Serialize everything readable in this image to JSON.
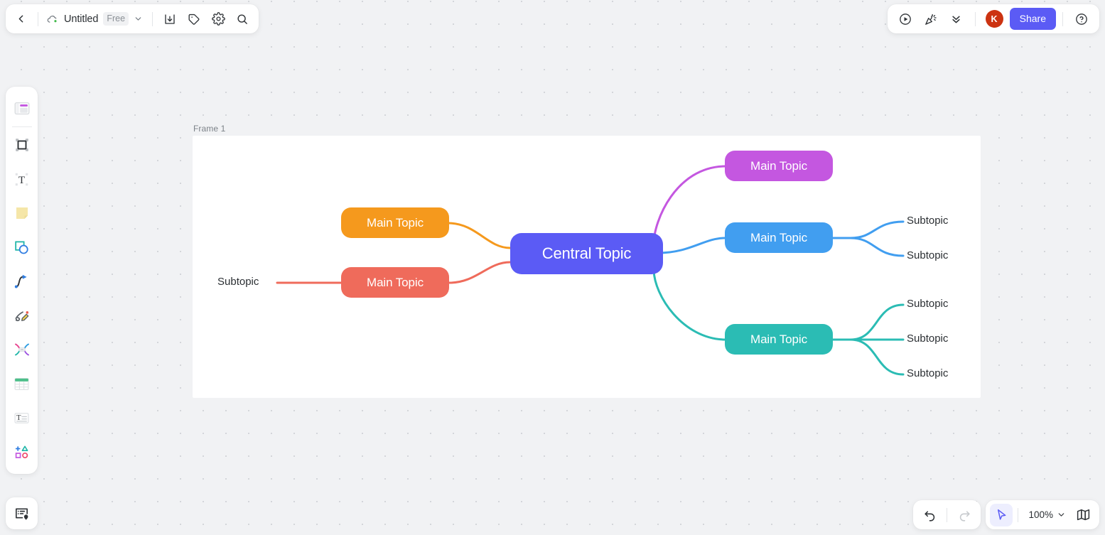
{
  "app": {
    "canvas_bg": "#f1f2f4",
    "accent": "#5b5bf5"
  },
  "topbar_left": {
    "back_icon": "chevron-left-icon",
    "cloud_icon": "cloud-saved-icon",
    "doc_title": "Untitled",
    "plan_badge": "Free",
    "caret_icon": "chevron-down-icon",
    "buttons": [
      {
        "name": "export-button",
        "icon": "download-icon"
      },
      {
        "name": "tag-button",
        "icon": "tag-icon"
      },
      {
        "name": "settings-button",
        "icon": "gear-icon"
      },
      {
        "name": "search-button",
        "icon": "search-icon"
      }
    ]
  },
  "topbar_right": {
    "buttons": [
      {
        "name": "present-button",
        "icon": "play-circle-icon"
      },
      {
        "name": "celebrate-button",
        "icon": "party-popper-icon"
      },
      {
        "name": "collapse-button",
        "icon": "chevrons-down-icon"
      }
    ],
    "avatar_initial": "K",
    "avatar_color": "#cc3311",
    "share_label": "Share",
    "help_icon": "question-circle-icon"
  },
  "tool_rail": {
    "items": [
      {
        "name": "template-tool",
        "icon": "template-icon"
      },
      {
        "name": "frame-tool",
        "icon": "frame-icon"
      },
      {
        "name": "text-tool",
        "icon": "text-box-icon"
      },
      {
        "name": "sticky-note-tool",
        "icon": "sticky-note-icon"
      },
      {
        "name": "shape-tool",
        "icon": "shapes-icon"
      },
      {
        "name": "connector-tool",
        "icon": "curve-connector-icon"
      },
      {
        "name": "pen-tool",
        "icon": "pencil-scribble-icon"
      },
      {
        "name": "mindmap-tool",
        "icon": "mindmap-icon"
      },
      {
        "name": "table-tool",
        "icon": "table-icon"
      },
      {
        "name": "comment-tool",
        "icon": "text-block-icon"
      },
      {
        "name": "more-tool",
        "icon": "add-shapes-icon"
      }
    ]
  },
  "bottom_left": {
    "name": "presentation-frames-button",
    "icon": "slide-pin-icon"
  },
  "bottom_right": {
    "undo_icon": "undo-arrow-icon",
    "redo_icon": "redo-arrow-icon",
    "cursor_icon": "cursor-pointer-icon",
    "zoom_level": "100%",
    "zoom_caret_icon": "chevron-down-icon",
    "minimap_icon": "map-icon"
  },
  "canvas": {
    "frame_label": "Frame 1"
  },
  "mindmap": {
    "central": {
      "label": "Central Topic",
      "color": "#5b5bf5"
    },
    "branches": [
      {
        "label": "Main Topic",
        "color": "#f5991d",
        "side": "left",
        "subtopics": []
      },
      {
        "label": "Main Topic",
        "color": "#ef6b5b",
        "side": "left",
        "subtopics": [
          {
            "label": "Subtopic"
          }
        ]
      },
      {
        "label": "Main Topic",
        "color": "#c457e0",
        "side": "right",
        "subtopics": []
      },
      {
        "label": "Main Topic",
        "color": "#419ef0",
        "side": "right",
        "subtopics": [
          {
            "label": "Subtopic"
          },
          {
            "label": "Subtopic"
          }
        ]
      },
      {
        "label": "Main Topic",
        "color": "#2bbcb4",
        "side": "right",
        "subtopics": [
          {
            "label": "Subtopic"
          },
          {
            "label": "Subtopic"
          },
          {
            "label": "Subtopic"
          }
        ]
      }
    ]
  }
}
